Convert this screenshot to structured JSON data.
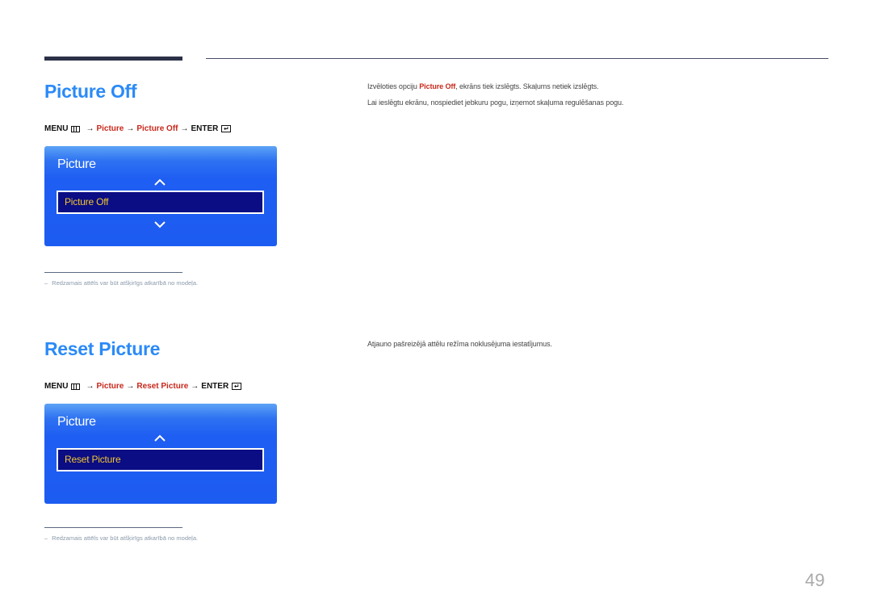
{
  "page_number": "49",
  "colors": {
    "title_blue": "#2b8af7",
    "path_red": "#c8281b",
    "panel_blue": "#1f5ef2",
    "selected_bg": "#0a0d83",
    "selected_text": "#f2c531"
  },
  "sections": [
    {
      "title": "Picture Off",
      "menu_path": {
        "menu": "MENU",
        "menu_icon": "menu-grid-icon",
        "arrow": "→",
        "step1": "Picture",
        "step2": "Picture Off",
        "enter": "ENTER",
        "enter_icon": "enter-icon"
      },
      "panel": {
        "title": "Picture",
        "selected_item": "Picture Off",
        "has_up": true,
        "has_down": true
      },
      "description": {
        "line1_prefix": "Izvēloties opciju ",
        "line1_highlight": "Picture Off",
        "line1_suffix": ", ekrāns tiek izslēgts. Skaļums netiek izslēgts.",
        "line2": "Lai ieslēgtu ekrānu, nospiediet jebkuru pogu, izņemot skaļuma regulēšanas pogu."
      },
      "footnote": {
        "dash": "–",
        "text": "Redzamais attēls var būt atšķirīgs atkarībā no modeļa."
      }
    },
    {
      "title": "Reset Picture",
      "menu_path": {
        "menu": "MENU",
        "menu_icon": "menu-grid-icon",
        "arrow": "→",
        "step1": "Picture",
        "step2": "Reset Picture",
        "enter": "ENTER",
        "enter_icon": "enter-icon"
      },
      "panel": {
        "title": "Picture",
        "selected_item": "Reset Picture",
        "has_up": true,
        "has_down": false
      },
      "description": {
        "line1": "Atjauno pašreizējā attēlu režīma noklusējuma iestatījumus."
      },
      "footnote": {
        "dash": "–",
        "text": "Redzamais attēls var būt atšķirīgs atkarībā no modeļa."
      }
    }
  ]
}
